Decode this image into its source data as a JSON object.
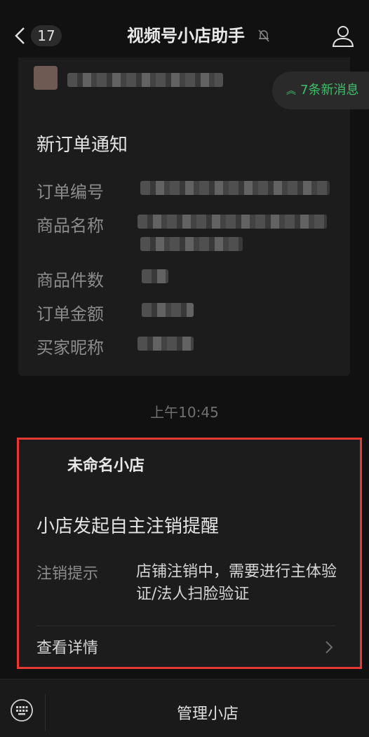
{
  "header": {
    "unread_count": "17",
    "title": "视频号小店助手"
  },
  "new_messages": "7条新消息",
  "order_card": {
    "title": "新订单通知",
    "rows": [
      {
        "label": "订单编号"
      },
      {
        "label": "商品名称"
      },
      {
        "label": "商品件数"
      },
      {
        "label": "订单金额"
      },
      {
        "label": "买家昵称"
      }
    ]
  },
  "timestamp": "上午10:45",
  "cancel_card": {
    "shop_name": "未命名小店",
    "title": "小店发起自主注销提醒",
    "label": "注销提示",
    "value": "店铺注销中，需要进行主体验证/法人扫脸验证",
    "detail_link": "查看详情"
  },
  "bottom_bar": {
    "menu_label": "管理小店"
  },
  "colors": {
    "accent_green": "#3fbf6a",
    "highlight_red": "#e53935"
  },
  "icons": [
    "back-chevron-icon",
    "mute-bell-icon",
    "person-icon",
    "double-chevron-up-icon",
    "chevron-right-icon",
    "keyboard-icon"
  ]
}
